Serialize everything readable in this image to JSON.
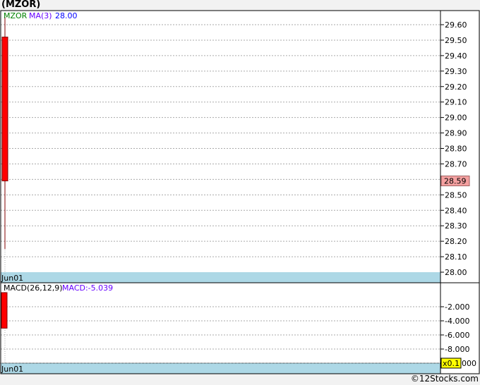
{
  "title": "(MZOR)",
  "copyright": "©12Stocks.com",
  "colors": {
    "candle": "#ff0000",
    "wick": "#800000",
    "date_bar": "#add8e6",
    "price_badge": "#f4a0a0",
    "scale_badge": "#ffff00"
  },
  "chart_data": [
    {
      "type": "candlestick",
      "legend": {
        "symbol": "MZOR",
        "ma_label": "MA(3)",
        "ma_value": "28.00"
      },
      "categories": [
        "Jun01"
      ],
      "candles": [
        {
          "date": "Jun01",
          "open": 29.52,
          "high": 29.65,
          "low": 28.15,
          "close": 28.59
        }
      ],
      "last_price": "28.59",
      "ylim": [
        28.0,
        29.6
      ],
      "yticks": [
        "29.60",
        "29.50",
        "29.40",
        "29.30",
        "29.20",
        "29.10",
        "29.00",
        "28.90",
        "28.80",
        "28.70",
        "28.60",
        "28.50",
        "28.40",
        "28.30",
        "28.20",
        "28.10",
        "28.00"
      ],
      "x_tick": "Jun01",
      "grid": true
    },
    {
      "type": "bar",
      "legend": {
        "label": "MACD(26,12,9)",
        "value_label": "MACD:-5.039"
      },
      "categories": [
        "Jun01"
      ],
      "values": [
        -5.039
      ],
      "ylim": [
        -10,
        0
      ],
      "yticks": [
        "-2.000",
        "-4.000",
        "-6.000",
        "-8.000",
        "000"
      ],
      "scale_badge": "x0.1",
      "x_tick": "Jun01",
      "grid": true
    }
  ]
}
